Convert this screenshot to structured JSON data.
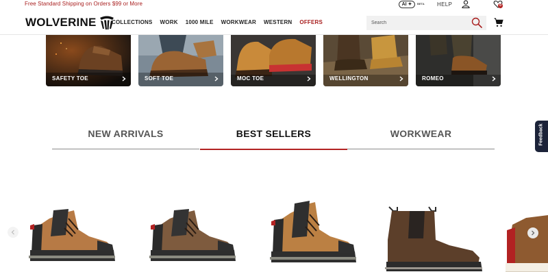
{
  "promo": {
    "text": "Free Standard Shipping on Orders $99 or More"
  },
  "utility": {
    "ai_label": "AI ✦",
    "ai_beta": "BETA",
    "help": "HELP",
    "wishlist_count": "0"
  },
  "brand": {
    "name": "WOLVERINE"
  },
  "nav": {
    "items": [
      "COLLECTIONS",
      "WORK",
      "1000 MILE",
      "WORKWEAR",
      "WESTERN",
      "OFFERS"
    ]
  },
  "search": {
    "placeholder": "Search"
  },
  "categories": [
    {
      "label": "SAFETY TOE"
    },
    {
      "label": "SOFT TOE"
    },
    {
      "label": "MOC TOE"
    },
    {
      "label": "WELLINGTON"
    },
    {
      "label": "ROMEO"
    }
  ],
  "tabs": [
    {
      "label": "NEW ARRIVALS",
      "active": false
    },
    {
      "label": "BEST SELLERS",
      "active": true
    },
    {
      "label": "WORKWEAR",
      "active": false
    }
  ],
  "feedback": {
    "label": "Feedback"
  },
  "colors": {
    "accent": "#b22222",
    "feedback_bg": "#1c2339",
    "brown": "#8a5a32",
    "tan": "#b9824a"
  }
}
